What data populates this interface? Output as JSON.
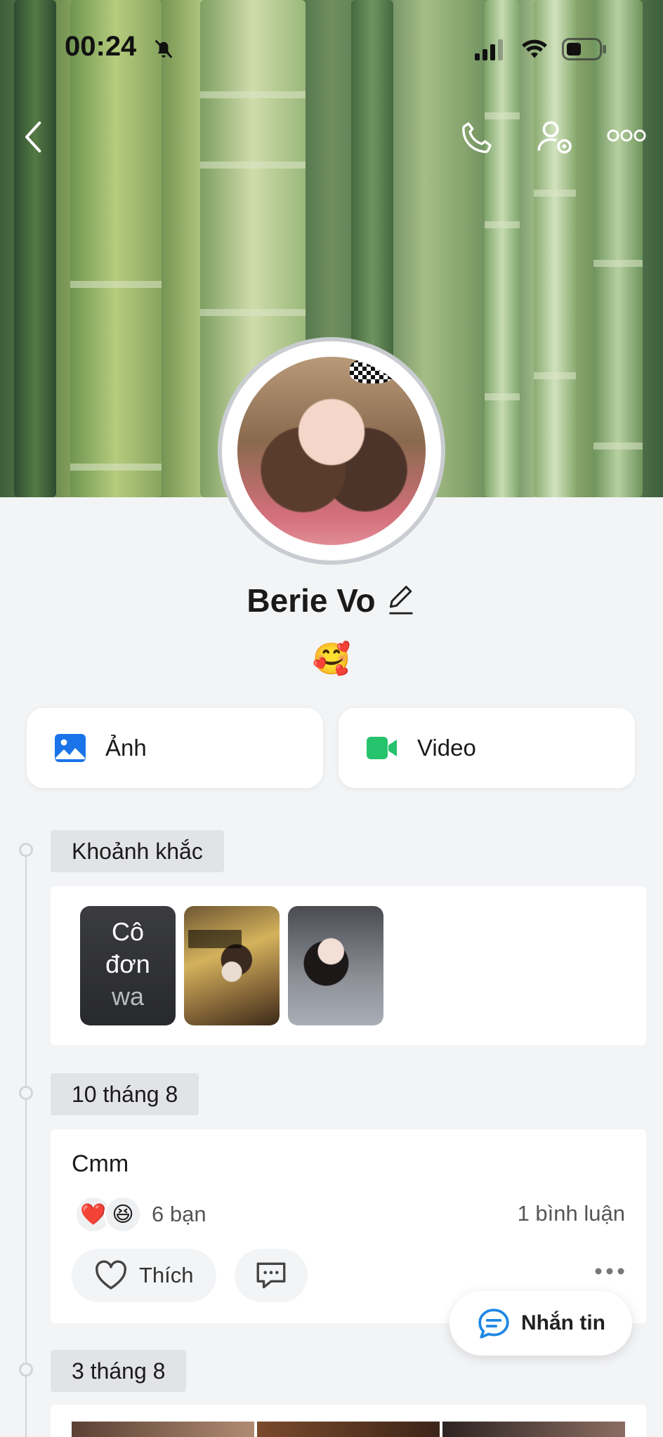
{
  "status_bar": {
    "time": "00:24"
  },
  "profile": {
    "name": "Berie Vo",
    "status_emoji": "🥰"
  },
  "media": {
    "photo_label": "Ảnh",
    "video_label": "Video"
  },
  "timeline": {
    "moments_tag": "Khoảnh khắc",
    "moments": [
      {
        "type": "text",
        "line1": "Cô",
        "line2": "đơn",
        "line3": "wa"
      },
      {
        "type": "image"
      },
      {
        "type": "image"
      }
    ],
    "post1": {
      "date": "10 tháng 8",
      "text": "Cmm",
      "reactions": [
        "❤️",
        "😆"
      ],
      "react_count": "6 bạn",
      "comment_count": "1 bình luận",
      "like_label": "Thích"
    },
    "post2": {
      "date": "3 tháng 8"
    }
  },
  "fab": {
    "message_label": "Nhắn tin"
  },
  "colors": {
    "photo_icon": "#1a73e8",
    "video_icon": "#27c26c",
    "message_icon": "#1e88e5"
  }
}
